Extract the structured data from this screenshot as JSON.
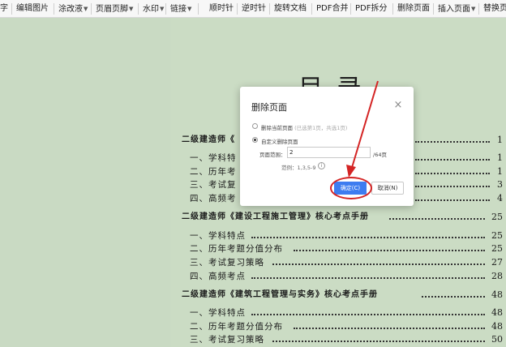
{
  "toolbar": {
    "items": [
      "字",
      "编辑图片",
      "涂改液",
      "页眉页脚",
      "水印",
      "链接",
      "顺时针",
      "逆时针",
      "旋转文档",
      "PDF合并",
      "PDF拆分",
      "删除页面",
      "插入页面",
      "替换页"
    ]
  },
  "document": {
    "toc_title": "目  录",
    "sections": [
      {
        "title": "二级建造师《",
        "page": "1",
        "items": [
          {
            "title": "一、学科特",
            "page": "1"
          },
          {
            "title": "二、历年考",
            "page": "1"
          },
          {
            "title": "三、考试复",
            "page": "3"
          },
          {
            "title": "四、高频考",
            "page": "4"
          }
        ]
      },
      {
        "title": "二级建造师《建设工程施工管理》核心考点手册",
        "page": "25",
        "items": [
          {
            "title": "一、学科特点",
            "page": "25"
          },
          {
            "title": "二、历年考题分值分布",
            "page": "25"
          },
          {
            "title": "三、考试复习策略",
            "page": "27"
          },
          {
            "title": "四、高频考点",
            "page": "28"
          }
        ]
      },
      {
        "title": "二级建造师《建筑工程管理与实务》核心考点手册",
        "page": "48",
        "items": [
          {
            "title": "一、学科特点",
            "page": "48"
          },
          {
            "title": "二、历年考题分值分布",
            "page": "48"
          },
          {
            "title": "三、考试复习策略",
            "page": "50"
          }
        ]
      }
    ]
  },
  "dialog": {
    "title": "删除页面",
    "option_current": "删除当前页面",
    "option_current_hint": "(已选第1页，共选1页)",
    "option_custom": "自定义删除页面",
    "range_label": "页面范围：",
    "range_value": "2",
    "range_total": "/64页",
    "example": "范例：1,3,5-9",
    "ok_label": "确定(C)",
    "cancel_label": "取消(N)",
    "selected_option": "custom"
  },
  "colors": {
    "page_bg": "#cbdcc4",
    "accent": "#3d7cf0",
    "annotation": "#d42424"
  }
}
